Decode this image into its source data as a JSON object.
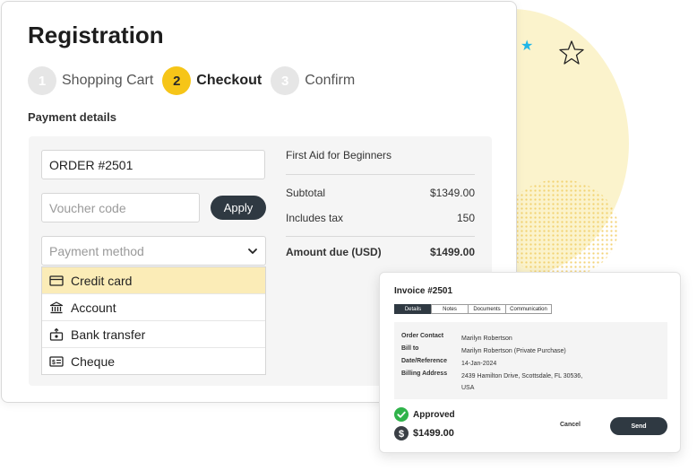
{
  "registration": {
    "title": "Registration",
    "steps": [
      {
        "num": "1",
        "label": "Shopping Cart"
      },
      {
        "num": "2",
        "label": "Checkout"
      },
      {
        "num": "3",
        "label": "Confirm"
      }
    ],
    "section_label": "Payment details",
    "order_value": "ORDER #2501",
    "voucher_placeholder": "Voucher code",
    "apply_label": "Apply",
    "payment_placeholder": "Payment method",
    "payment_options": [
      {
        "label": "Credit card",
        "icon": "credit-card-icon"
      },
      {
        "label": "Account",
        "icon": "bank-icon"
      },
      {
        "label": "Bank transfer",
        "icon": "transfer-icon"
      },
      {
        "label": "Cheque",
        "icon": "cheque-icon"
      }
    ],
    "selected_option": "Credit card",
    "summary": {
      "item": "First Aid for Beginners",
      "subtotal_label": "Subtotal",
      "subtotal_value": "$1349.00",
      "tax_label": "Includes tax",
      "tax_value": "150",
      "due_label": "Amount due (USD)",
      "due_value": "$1499.00"
    }
  },
  "invoice": {
    "title": "Invoice #2501",
    "tabs": [
      "Details",
      "Notes",
      "Documents",
      "Communication"
    ],
    "active_tab": "Details",
    "rows": [
      {
        "key": "Order Contact",
        "value": "Marilyn Robertson"
      },
      {
        "key": "Bill to",
        "value": "Marilyn Robertson (Private Purchase)"
      },
      {
        "key": "Date/Reference",
        "value": "14-Jan-2024"
      },
      {
        "key": "Billing Address",
        "value": "2439 Hamilton Drive, Scottsdale, FL 30536, USA"
      }
    ],
    "status": "Approved",
    "amount": "$1499.00",
    "cancel_label": "Cancel",
    "send_label": "Send"
  },
  "colors": {
    "accent": "#f6c518",
    "dark": "#2f3942",
    "selected_bg": "#fbecb7",
    "approved": "#2fb34a",
    "bg_circle": "#fbf3cc"
  }
}
